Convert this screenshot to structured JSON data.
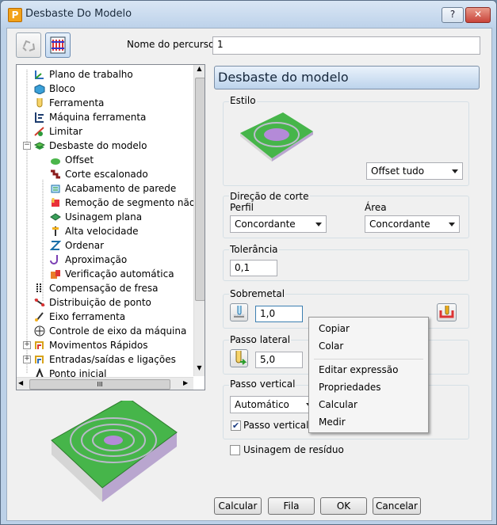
{
  "window": {
    "title": "Desbaste Do Modelo",
    "help_label": "?",
    "close_label": "✕"
  },
  "toolpath_name": {
    "label": "Nome do percurso",
    "value": "1"
  },
  "tree": {
    "items": [
      {
        "label": "Plano de trabalho"
      },
      {
        "label": "Bloco"
      },
      {
        "label": "Ferramenta"
      },
      {
        "label": "Máquina ferramenta"
      },
      {
        "label": "Limitar"
      },
      {
        "label": "Desbaste do modelo"
      },
      {
        "label": "Offset"
      },
      {
        "label": "Corte escalonado"
      },
      {
        "label": "Acabamento de parede"
      },
      {
        "label": "Remoção de segmento não se"
      },
      {
        "label": "Usinagem plana"
      },
      {
        "label": "Alta velocidade"
      },
      {
        "label": "Ordenar"
      },
      {
        "label": "Aproximação"
      },
      {
        "label": "Verificação automática"
      },
      {
        "label": "Compensação de fresa"
      },
      {
        "label": "Distribuição de ponto"
      },
      {
        "label": "Eixo ferramenta"
      },
      {
        "label": "Controle de eixo da máquina"
      },
      {
        "label": "Movimentos Rápidos"
      },
      {
        "label": "Entradas/saídas e ligações"
      },
      {
        "label": "Ponto inicial"
      }
    ],
    "expanded_symbol": "−",
    "collapsed_symbol": "+",
    "scroll_thumb": "III"
  },
  "panel_title": "Desbaste do modelo",
  "style": {
    "label": "Estilo",
    "selected": "Offset tudo"
  },
  "cut_direction": {
    "label": "Direção de corte",
    "profile_label": "Perfil",
    "profile_value": "Concordante",
    "area_label": "Área",
    "area_value": "Concordante"
  },
  "tolerance": {
    "label": "Tolerância",
    "value": "0,1"
  },
  "stock": {
    "label": "Sobremetal",
    "value": "1,0"
  },
  "stepover": {
    "label": "Passo lateral",
    "value": "5,0"
  },
  "stepdown": {
    "label": "Passo vertical",
    "selected": "Automático",
    "checkbox_label": "Passo vertical",
    "checked": true
  },
  "rest_machining": {
    "label": "Usinagem de resíduo",
    "checked": false
  },
  "context_menu": {
    "items": [
      "Copiar",
      "Colar",
      "Editar expressão",
      "Propriedades",
      "Calcular",
      "Medir"
    ]
  },
  "buttons": {
    "calculate": "Calcular",
    "queue": "Fila",
    "ok": "OK",
    "cancel": "Cancelar"
  },
  "colors": {
    "green": "#7fd35b",
    "purple": "#b48ad8",
    "accent_blue": "#bcd3ec"
  }
}
